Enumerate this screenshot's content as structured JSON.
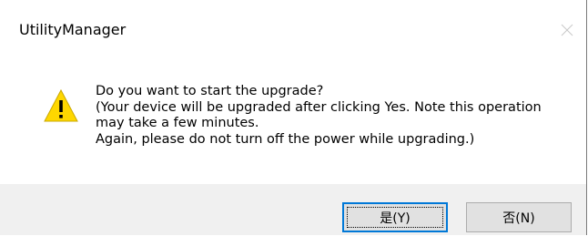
{
  "window": {
    "title": "UtilityManager",
    "close_icon": "close-icon"
  },
  "message": {
    "icon": "warning-icon",
    "lines": [
      "Do you want to start the upgrade?",
      "(Your device will be upgraded after clicking Yes. Note this operation",
      "may take a few minutes.",
      "Again, please do not turn off the power while upgrading.)"
    ]
  },
  "buttons": {
    "yes_label": "是(Y)",
    "no_label": "否(N)"
  },
  "colors": {
    "footer_bg": "#f0f0f0",
    "focus_border": "#0078d7",
    "warning_yellow": "#ffd700"
  }
}
